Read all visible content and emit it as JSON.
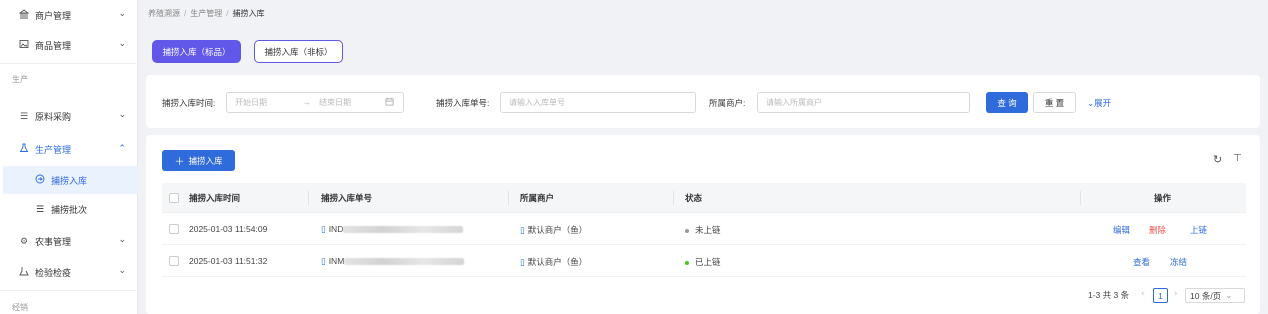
{
  "sidebar": {
    "top_items": [
      {
        "label": "商户管理",
        "icon": "bank-icon"
      },
      {
        "label": "商品管理",
        "icon": "image-icon"
      }
    ],
    "group_production": "生产",
    "items": [
      {
        "label": "原料采购",
        "icon": "list-icon"
      },
      {
        "label": "生产管理",
        "icon": "flask-icon"
      }
    ],
    "sub_items": [
      {
        "label": "捕捞入库",
        "icon": "enter-icon"
      },
      {
        "label": "捕捞批次",
        "icon": "list-icon"
      }
    ],
    "bottom_items": [
      {
        "label": "农事管理",
        "icon": "gear-icon"
      },
      {
        "label": "检验检疫",
        "icon": "inspect-icon"
      }
    ],
    "group_sales": "经销"
  },
  "breadcrumb": {
    "items": [
      "养殖溯源",
      "生产管理",
      "捕捞入库"
    ],
    "sep": "/"
  },
  "tabs": {
    "standard": "捕捞入库（标品）",
    "non_standard": "捕捞入库（非标）"
  },
  "filters": {
    "time_label": "捕捞入库时间:",
    "start_placeholder": "开始日期",
    "arrow": "→",
    "end_placeholder": "结束日期",
    "order_label": "捕捞入库单号:",
    "order_placeholder": "请输入入库单号",
    "merchant_label": "所属商户:",
    "merchant_placeholder": "请输入所属商户",
    "query": "查 询",
    "reset": "重 置",
    "expand": "展开"
  },
  "table": {
    "add_button": "捕捞入库",
    "columns": [
      "捕捞入库时间",
      "捕捞入库单号",
      "所属商户",
      "状态",
      "操作"
    ],
    "rows": [
      {
        "time": "2025-01-03 11:54:09",
        "order_prefix": "IND",
        "merchant": "默认商户（鱼）",
        "status": "未上链",
        "status_color": "#999999",
        "actions": [
          "编辑",
          "删除",
          "上链"
        ]
      },
      {
        "time": "2025-01-03 11:51:32",
        "order_prefix": "INM",
        "merchant": "默认商户（鱼）",
        "status": "已上链",
        "status_color": "#52c41a",
        "actions": [
          "查看",
          "冻结"
        ]
      }
    ]
  },
  "pagination": {
    "summary": "1-3 共 3 条",
    "current_page": "1",
    "page_size": "10 条/页"
  },
  "colors": {
    "primary": "#2f6bdb",
    "tab_active": "#6157e8",
    "danger": "#ef5350"
  }
}
